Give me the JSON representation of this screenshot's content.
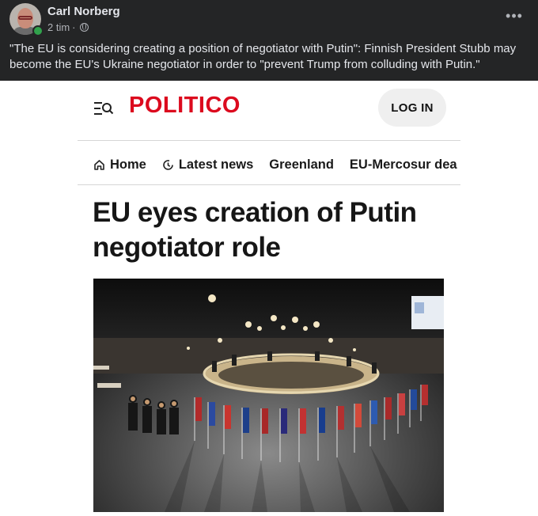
{
  "post": {
    "author": "Carl Norberg",
    "time": "2 tim",
    "separator": "·",
    "more_icon": "more-horizontal-icon",
    "privacy_icon": "globe-icon",
    "text": "\"The EU is considering creating a position of negotiator with Putin\": Finnish President Stubb may become the EU's Ukraine negotiator in order to \"prevent Trump from colluding with Putin.\""
  },
  "article": {
    "logo": "POLITICO",
    "login_label": "LOG IN",
    "nav": [
      {
        "label": "Home",
        "icon": "home-icon"
      },
      {
        "label": "Latest news",
        "icon": "clock-icon"
      },
      {
        "label": "Greenland",
        "icon": ""
      },
      {
        "label": "EU-Mercosur deal",
        "icon": ""
      }
    ],
    "headline": "EU eyes creation of Putin negotiator role"
  },
  "colors": {
    "facebook_bg": "#242526",
    "politico_red": "#dc0a1e",
    "online_green": "#31a24c"
  }
}
